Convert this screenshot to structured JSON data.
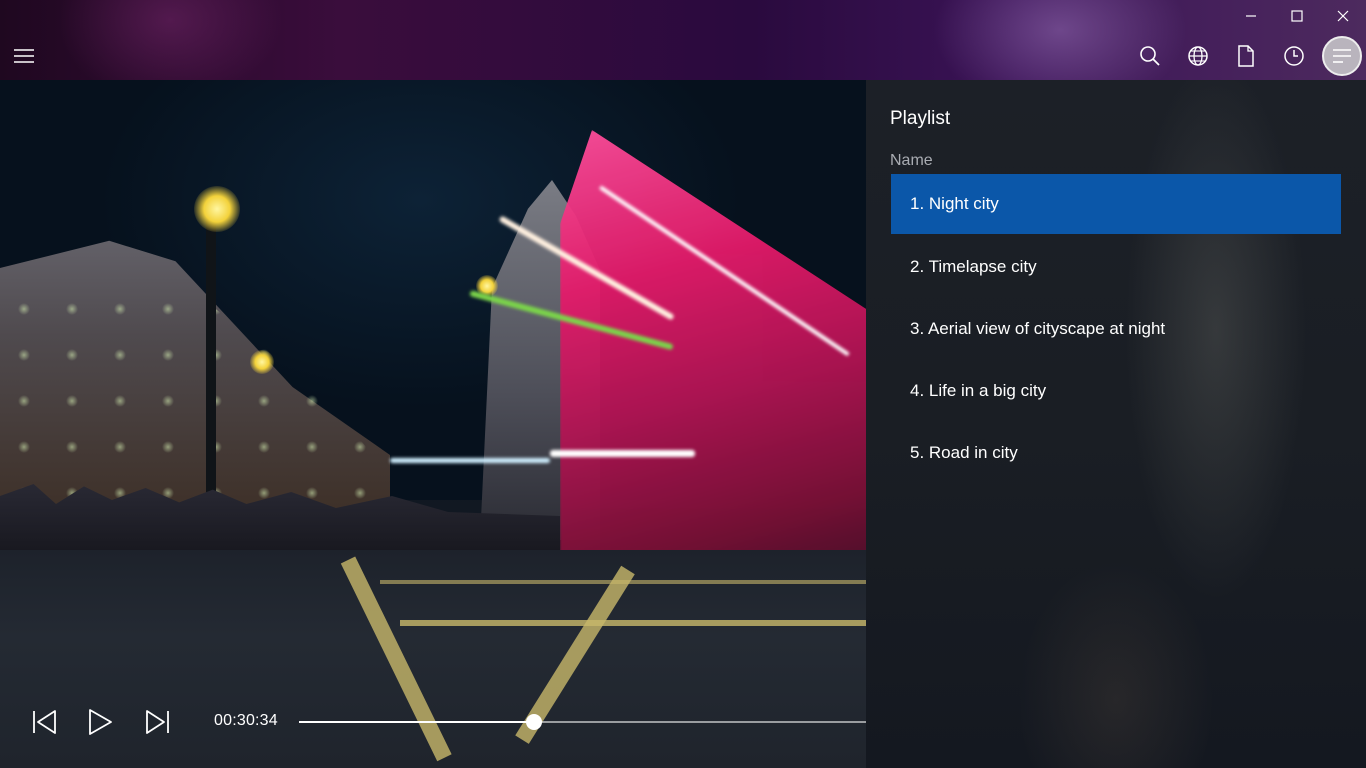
{
  "window": {
    "controls": [
      {
        "name": "minimize-button",
        "icon": "minimize-icon"
      },
      {
        "name": "maximize-button",
        "icon": "maximize-icon"
      },
      {
        "name": "close-button",
        "icon": "close-icon"
      }
    ]
  },
  "header": {
    "menu_icon": "hamburger-icon",
    "toolbar": [
      {
        "name": "search-button",
        "icon": "search-icon"
      },
      {
        "name": "web-button",
        "icon": "globe-icon"
      },
      {
        "name": "open-file-button",
        "icon": "file-icon"
      },
      {
        "name": "recent-button",
        "icon": "clock-icon"
      },
      {
        "name": "playlist-button",
        "icon": "playlist-icon",
        "active": true
      }
    ]
  },
  "player": {
    "time": "00:30:34",
    "progress": 0.415,
    "buttons": {
      "previous": "skip-previous-icon",
      "play": "play-icon",
      "next": "skip-next-icon"
    }
  },
  "playlist": {
    "title": "Playlist",
    "column_header": "Name",
    "selected_index": 0,
    "selected_color": "#0b57a9",
    "items": [
      "1. Night city",
      "2. Timelapse city",
      "3. Aerial view of cityscape at night",
      "4. Life in a big city",
      "5. Road in city"
    ]
  }
}
